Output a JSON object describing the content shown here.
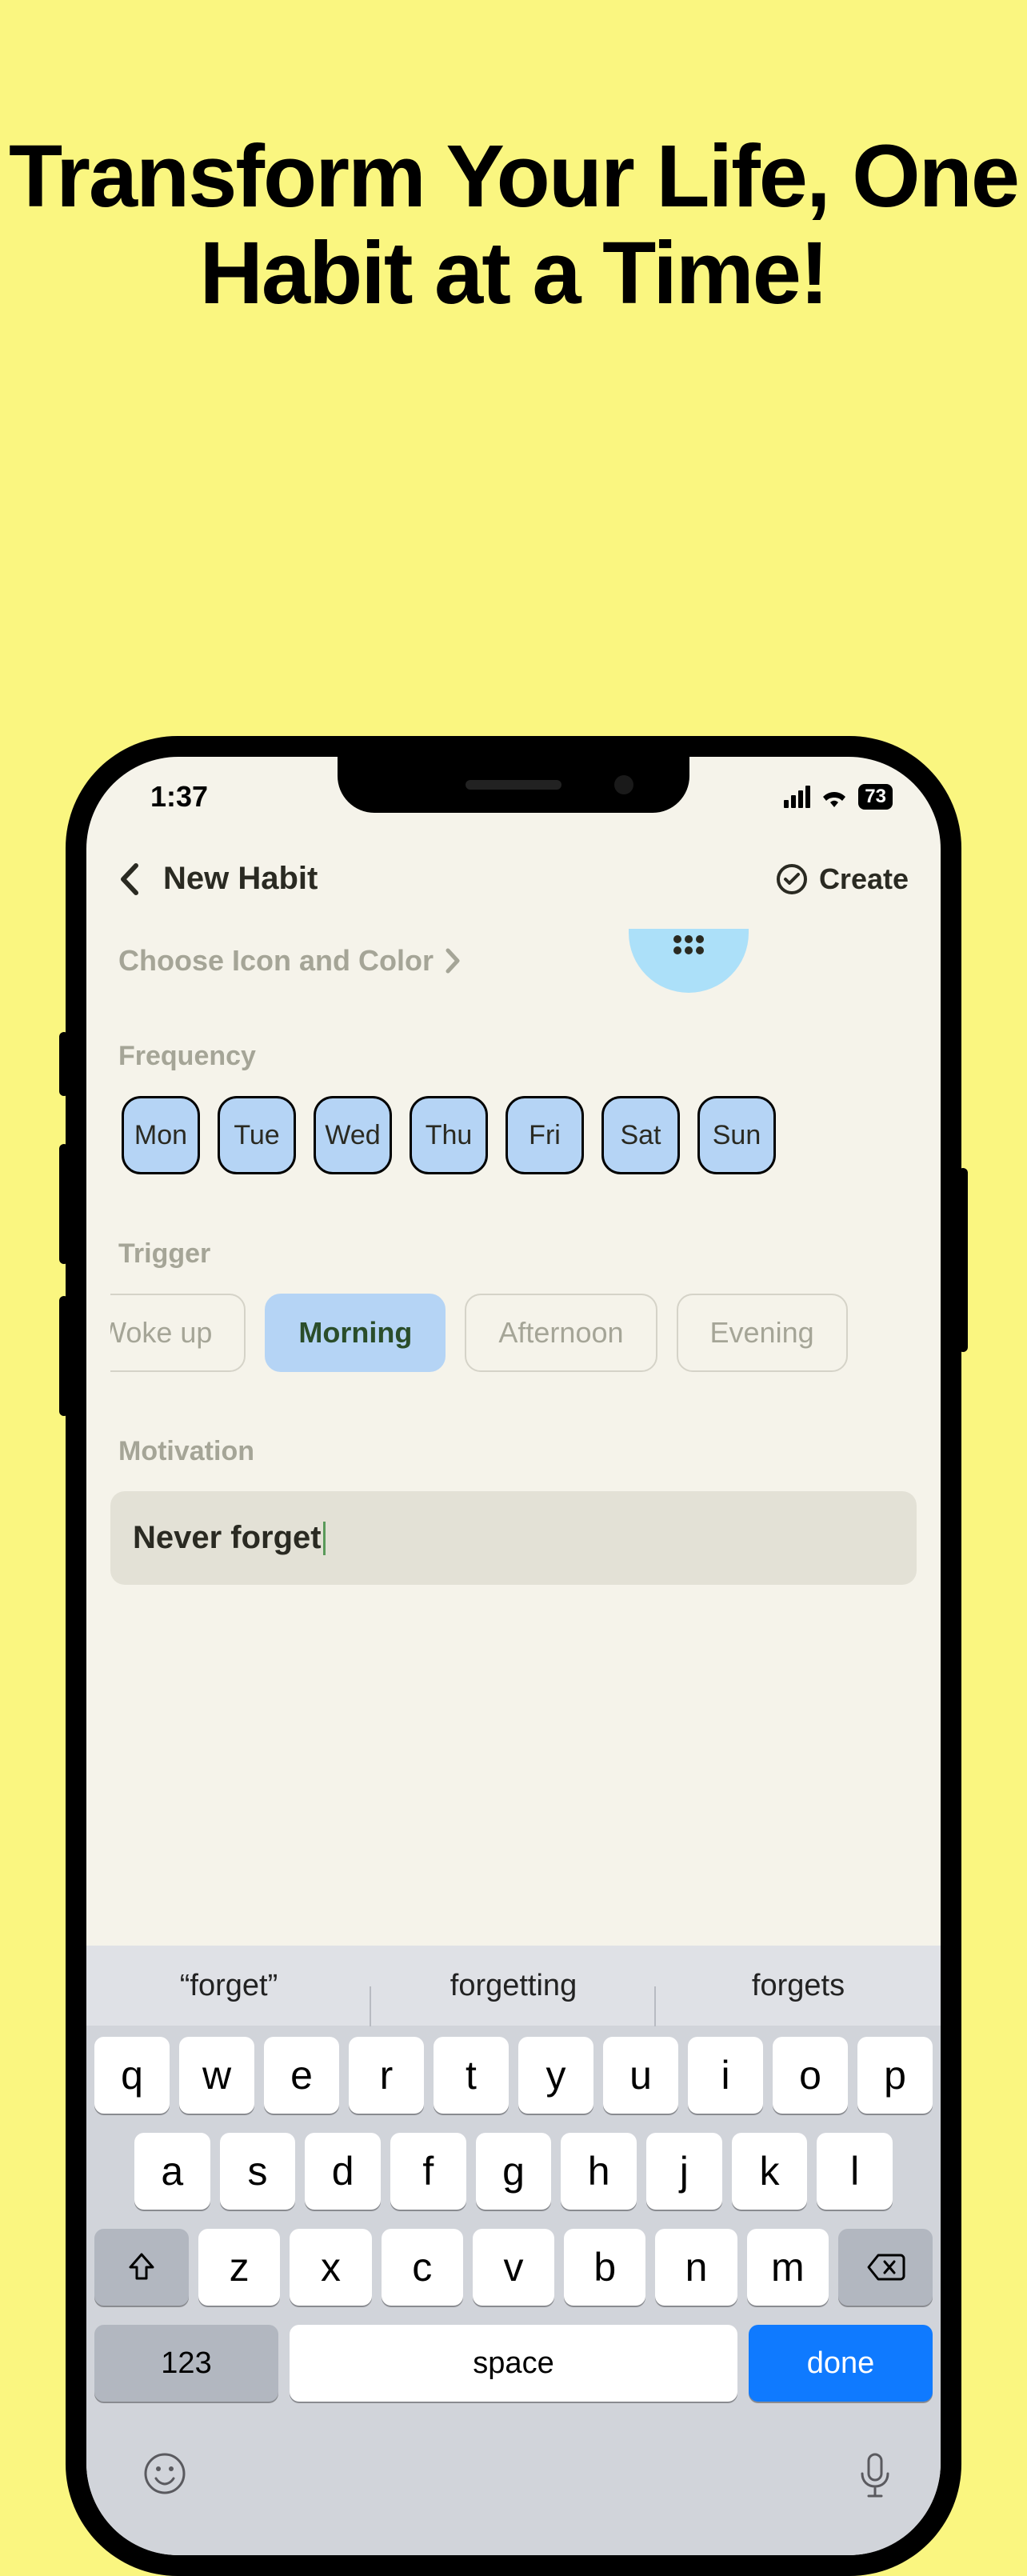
{
  "marketing": {
    "headline": "Transform Your Life, One Habit at a Time!"
  },
  "status": {
    "time": "1:37",
    "battery": "73"
  },
  "nav": {
    "title": "New Habit",
    "action": "Create"
  },
  "iconColor": {
    "label": "Choose Icon and Color"
  },
  "frequency": {
    "label": "Frequency",
    "days": [
      "Mon",
      "Tue",
      "Wed",
      "Thu",
      "Fri",
      "Sat",
      "Sun"
    ]
  },
  "trigger": {
    "label": "Trigger",
    "options": [
      "Woke up",
      "Morning",
      "Afternoon",
      "Evening"
    ],
    "selected": "Morning"
  },
  "motivation": {
    "label": "Motivation",
    "value": "Never forget"
  },
  "keyboard": {
    "suggestions": [
      "“forget”",
      "forgetting",
      "forgets"
    ],
    "row1": [
      "q",
      "w",
      "e",
      "r",
      "t",
      "y",
      "u",
      "i",
      "o",
      "p"
    ],
    "row2": [
      "a",
      "s",
      "d",
      "f",
      "g",
      "h",
      "j",
      "k",
      "l"
    ],
    "row3": [
      "z",
      "x",
      "c",
      "v",
      "b",
      "n",
      "m"
    ],
    "numKey": "123",
    "space": "space",
    "action": "done"
  }
}
